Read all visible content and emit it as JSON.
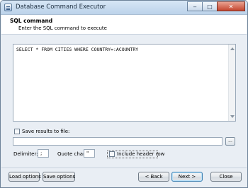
{
  "window": {
    "title": "Database Command Executor",
    "minimize": "‒",
    "maximize": "□",
    "close": "✕"
  },
  "header": {
    "title": "SQL command",
    "subtitle": "Enter the SQL command to execute"
  },
  "sql": {
    "text": "SELECT * FROM CITIES WHERE COUNTRY=:ACOUNTRY"
  },
  "save": {
    "checkbox_label": "Save results to file:",
    "checked": false,
    "file_path": "",
    "browse_label": "..."
  },
  "options": {
    "delimiter_label": "Delimiter:",
    "delimiter_value": ";",
    "quote_label": "Quote char:",
    "quote_value": "\"",
    "include_header_label": "Include header row",
    "include_header_checked": false
  },
  "buttons": {
    "load": "Load options",
    "save": "Save options",
    "back": "< Back",
    "next": "Next >",
    "close": "Close"
  }
}
